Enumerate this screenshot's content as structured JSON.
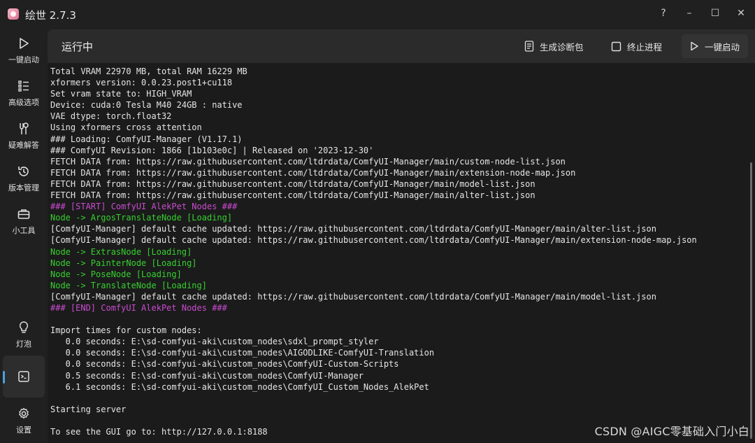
{
  "app": {
    "title": "绘世 2.7.3"
  },
  "window_controls": {
    "help": "?",
    "minimize": "–",
    "maximize": "☐",
    "close": "✕"
  },
  "sidebar": {
    "items": [
      {
        "label": "一键启动",
        "icon": "play-icon"
      },
      {
        "label": "高级选项",
        "icon": "list-icon"
      },
      {
        "label": "疑难解答",
        "icon": "tools-icon"
      },
      {
        "label": "版本管理",
        "icon": "history-icon"
      },
      {
        "label": "小工具",
        "icon": "toolbox-icon"
      },
      {
        "label": "灯泡",
        "icon": "lightbulb-icon"
      },
      {
        "label": "",
        "icon": "console-icon",
        "active": true
      },
      {
        "label": "设置",
        "icon": "gear-icon"
      }
    ]
  },
  "toolbar": {
    "title": "运行中",
    "diagnostic_label": "生成诊断包",
    "terminate_label": "终止进程",
    "launch_label": "一键启动"
  },
  "console": {
    "lines": [
      {
        "text": "Total VRAM 22970 MB, total RAM 16229 MB",
        "color": "default"
      },
      {
        "text": "xformers version: 0.0.23.post1+cu118",
        "color": "default"
      },
      {
        "text": "Set vram state to: HIGH_VRAM",
        "color": "default"
      },
      {
        "text": "Device: cuda:0 Tesla M40 24GB : native",
        "color": "default"
      },
      {
        "text": "VAE dtype: torch.float32",
        "color": "default"
      },
      {
        "text": "Using xformers cross attention",
        "color": "default"
      },
      {
        "text": "### Loading: ComfyUI-Manager (V1.17.1)",
        "color": "default"
      },
      {
        "text": "### ComfyUI Revision: 1866 [1b103e0c] | Released on '2023-12-30'",
        "color": "default"
      },
      {
        "text": "FETCH DATA from: https://raw.githubusercontent.com/ltdrdata/ComfyUI-Manager/main/custom-node-list.json",
        "color": "default"
      },
      {
        "text": "FETCH DATA from: https://raw.githubusercontent.com/ltdrdata/ComfyUI-Manager/main/extension-node-map.json",
        "color": "default"
      },
      {
        "text": "FETCH DATA from: https://raw.githubusercontent.com/ltdrdata/ComfyUI-Manager/main/model-list.json",
        "color": "default"
      },
      {
        "text": "FETCH DATA from: https://raw.githubusercontent.com/ltdrdata/ComfyUI-Manager/main/alter-list.json",
        "color": "default"
      },
      {
        "text": "### [START] ComfyUI AlekPet Nodes ###",
        "color": "magenta"
      },
      {
        "text": "Node -> ArgosTranslateNode [Loading]",
        "color": "green"
      },
      {
        "text": "[ComfyUI-Manager] default cache updated: https://raw.githubusercontent.com/ltdrdata/ComfyUI-Manager/main/alter-list.json",
        "color": "default"
      },
      {
        "text": "[ComfyUI-Manager] default cache updated: https://raw.githubusercontent.com/ltdrdata/ComfyUI-Manager/main/extension-node-map.json",
        "color": "default"
      },
      {
        "text": "Node -> ExtrasNode [Loading]",
        "color": "green"
      },
      {
        "text": "Node -> PainterNode [Loading]",
        "color": "green"
      },
      {
        "text": "Node -> PoseNode [Loading]",
        "color": "green"
      },
      {
        "text": "Node -> TranslateNode [Loading]",
        "color": "green"
      },
      {
        "text": "[ComfyUI-Manager] default cache updated: https://raw.githubusercontent.com/ltdrdata/ComfyUI-Manager/main/model-list.json",
        "color": "default"
      },
      {
        "text": "### [END] ComfyUI AlekPet Nodes ###",
        "color": "magenta"
      },
      {
        "text": "",
        "color": "default"
      },
      {
        "text": "Import times for custom nodes:",
        "color": "default"
      },
      {
        "text": "   0.0 seconds: E:\\sd-comfyui-aki\\custom_nodes\\sdxl_prompt_styler",
        "color": "default"
      },
      {
        "text": "   0.0 seconds: E:\\sd-comfyui-aki\\custom_nodes\\AIGODLIKE-ComfyUI-Translation",
        "color": "default"
      },
      {
        "text": "   0.0 seconds: E:\\sd-comfyui-aki\\custom_nodes\\ComfyUI-Custom-Scripts",
        "color": "default"
      },
      {
        "text": "   0.5 seconds: E:\\sd-comfyui-aki\\custom_nodes\\ComfyUI-Manager",
        "color": "default"
      },
      {
        "text": "   6.1 seconds: E:\\sd-comfyui-aki\\custom_nodes\\ComfyUI_Custom_Nodes_AlekPet",
        "color": "default"
      },
      {
        "text": "",
        "color": "default"
      },
      {
        "text": "Starting server",
        "color": "default"
      },
      {
        "text": "",
        "color": "default"
      },
      {
        "text": "To see the GUI go to: http://127.0.0.1:8188",
        "color": "default"
      }
    ]
  },
  "watermark": "CSDN @AIGC零基础入门小白"
}
